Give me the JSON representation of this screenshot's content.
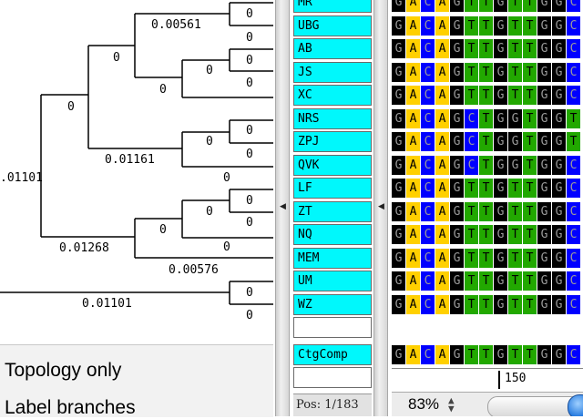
{
  "tree": {
    "branch_labels": {
      "top_pair": "0.00561",
      "mr": "0",
      "ubg": "0",
      "upper_left": "0",
      "js_group": "0",
      "ab": "0",
      "js": "0",
      "xc_branch": "0",
      "upper_clade": "0",
      "nrs_group": "0",
      "nrs": "0",
      "zpj": "0",
      "mid_clade": "0.01161",
      "qvk": "0",
      "root_branch": ".01101",
      "lf_group": "0",
      "lf": "0",
      "zt": "0",
      "nq_group": "0",
      "nq": "0",
      "lower_clade": "0.01268",
      "mem": "0.00576",
      "um": "0",
      "wz": "0",
      "bottom_clade": "0.01101"
    }
  },
  "options": {
    "topology_only": "Topology only",
    "label_branches": "Label branches"
  },
  "sequences": {
    "names": [
      "MR",
      "UBG",
      "AB",
      "JS",
      "XC",
      "NRS",
      "ZPJ",
      "QVK",
      "LF",
      "ZT",
      "NQ",
      "MEM",
      "UM",
      "WZ"
    ],
    "rows": [
      "GACAGTTGTTGGC",
      "GACAGTTGTTGGC",
      "GACAGTTGTTGGC",
      "GACAGTTGTTGGC",
      "GACAGTTGTTGGC",
      "GACAGCTGGTGGT",
      "GACAGCTGGTGGT",
      "GACAGCTGGTGGC",
      "GACAGTTGTTGGC",
      "GACAGTTGTTGGC",
      "GACAGTTGTTGGC",
      "GACAGTTGTTGGC",
      "GACAGTTGTTGGC",
      "GACAGTTGTTGGC"
    ],
    "consensus_name": "CtgComp",
    "consensus": "GACAGTTGTTGGC",
    "ruler_label": "150",
    "position": "Pos: 1/183",
    "zoom": "83%"
  },
  "colors": {
    "A": "#ffd000",
    "C": "#0000ff",
    "G": "#000000",
    "T": "#22a800",
    "name_bg": "#00f8fc"
  }
}
